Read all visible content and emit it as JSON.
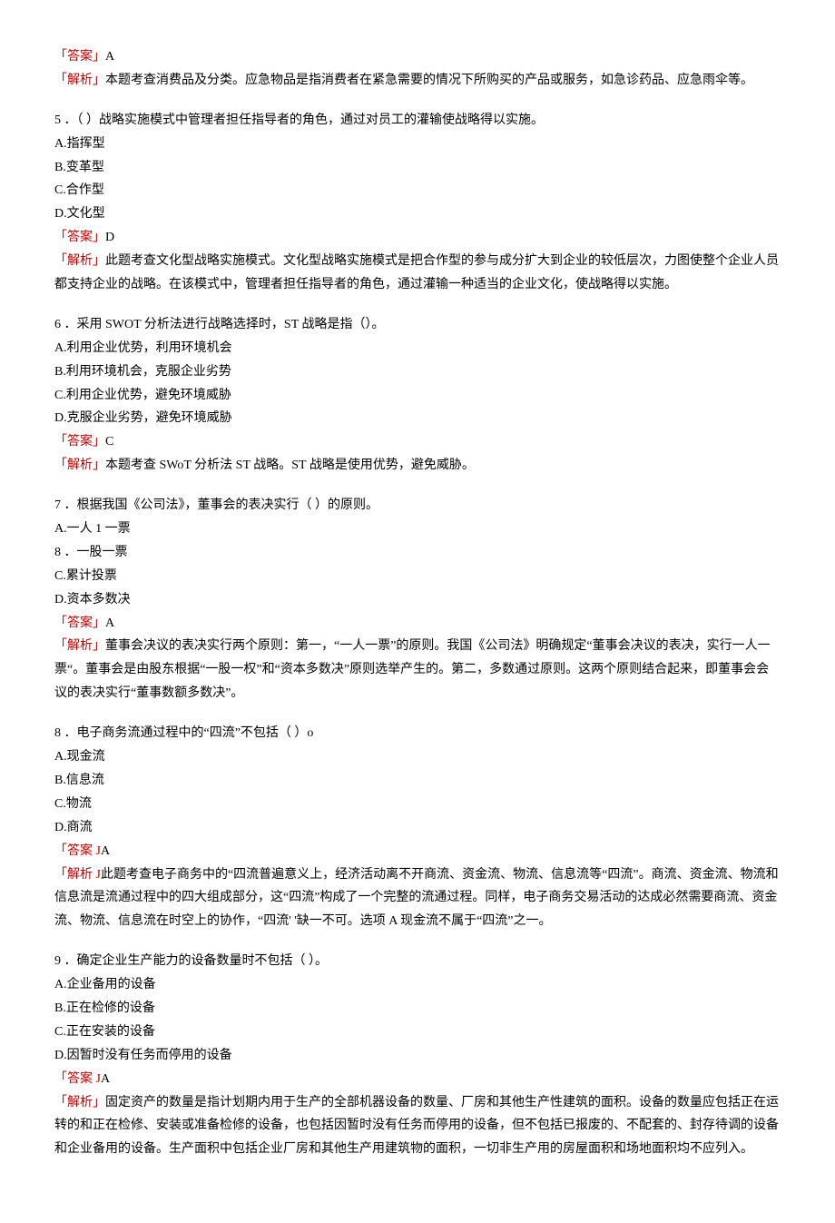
{
  "q4_answer_label": "「答案」",
  "q4_answer_value": "A",
  "q4_analysis_label": "「解析」",
  "q4_analysis_text": "本题考查消费品及分类。应急物品是指消费者在紧急需要的情况下所购买的产品或服务，如急诊药品、应急雨伞等。",
  "q5_stem": "5 ．（   ）战略实施模式中管理者担任指导者的角色，通过对员工的灌输使战略得以实施。",
  "q5_optA": "A.指挥型",
  "q5_optB": "B.变革型",
  "q5_optC": "C.合作型",
  "q5_optD": "D.文化型",
  "q5_answer_label": "「答案」",
  "q5_answer_value": "D",
  "q5_analysis_label": "「解析」",
  "q5_analysis_text": "此题考查文化型战略实施模式。文化型战略实施模式是把合作型的参与成分扩大到企业的较低层次，力图使整个企业人员都支持企业的战略。在该模式中，管理者担任指导者的角色，通过灌输一种适当的企业文化，使战略得以实施。",
  "q6_stem": "6 ．采用 SWOT 分析法进行战略选择时，ST 战略是指（）。",
  "q6_optA": "A.利用企业优势，利用环境机会",
  "q6_optB": "B.利用环境机会，克服企业劣势",
  "q6_optC": "C.利用企业优势，避免环境威胁",
  "q6_optD": "D.克服企业劣势，避免环境威胁",
  "q6_answer_label": "「答案」",
  "q6_answer_value": "C",
  "q6_analysis_label": "「解析」",
  "q6_analysis_text": "本题考查 SWoT 分析法 ST 战略。ST 战略是使用优势，避免威胁。",
  "q7_stem": "7 ．根据我国《公司法》，董事会的表决实行（   ）的原则。",
  "q7_optA": "A.一人 1 一票",
  "q7_line8": "8  ．一股一票",
  "q7_optC": "C.累计投票",
  "q7_optD": "D.资本多数决",
  "q7_answer_label": "「答案」",
  "q7_answer_value": "A",
  "q7_analysis_label": "「解析」",
  "q7_analysis_text": "董事会决议的表决实行两个原则：第一，“一人一票”的原则。我国《公司法》明确规定“董事会决议的表决，实行一人一票“。董事会是由股东根据“一股一权”和“资本多数决”原则选举产生的。第二，多数通过原则。这两个原则结合起来，即董事会会议的表决实行“董事数额多数决”。",
  "q8_stem": "8 ．电子商务流通过程中的“四流”不包括（  ）o",
  "q8_optA": "A.现金流",
  "q8_optB": "B.信息流",
  "q8_optC": "C.物流",
  "q8_optD": "D.商流",
  "q8_answer_label": "「答案 J",
  "q8_answer_value": "A",
  "q8_analysis_label": "「解析 J",
  "q8_analysis_text": "此题考查电子商务中的“四流普遍意义上，经济活动离不开商流、资金流、物流、信息流等“四流”。商流、资金流、物流和信息流是流通过程中的四大组成部分，这“四流”构成了一个完整的流通过程。同样，电子商务交易活动的达成必然需要商流、资金流、物流、信息流在时空上的协作，“四流' '缺一不可。选项 A 现金流不属于“四流”之一。",
  "q9_stem": "9 ．确定企业生产能力的设备数量时不包括（    ）。",
  "q9_optA": "A.企业备用的设备",
  "q9_optB": "B.正在检修的设备",
  "q9_optC": "C.正在安装的设备",
  "q9_optD": "D.因暂时没有任务而停用的设备",
  "q9_answer_label": "「答案 J",
  "q9_answer_value": "A",
  "q9_analysis_label": "「解析」",
  "q9_analysis_text": "固定资产的数量是指计划期内用于生产的全部机器设备的数量、厂房和其他生产性建筑的面积。设备的数量应包括正在运转的和正在检修、安装或准备检修的设备，也包括因暂时没有任务而停用的设备，但不包括已报废的、不配套的、封存待调的设备和企业备用的设备。生产面积中包括企业厂房和其他生产用建筑物的面积，一切非生产用的房屋面积和场地面积均不应列入。"
}
